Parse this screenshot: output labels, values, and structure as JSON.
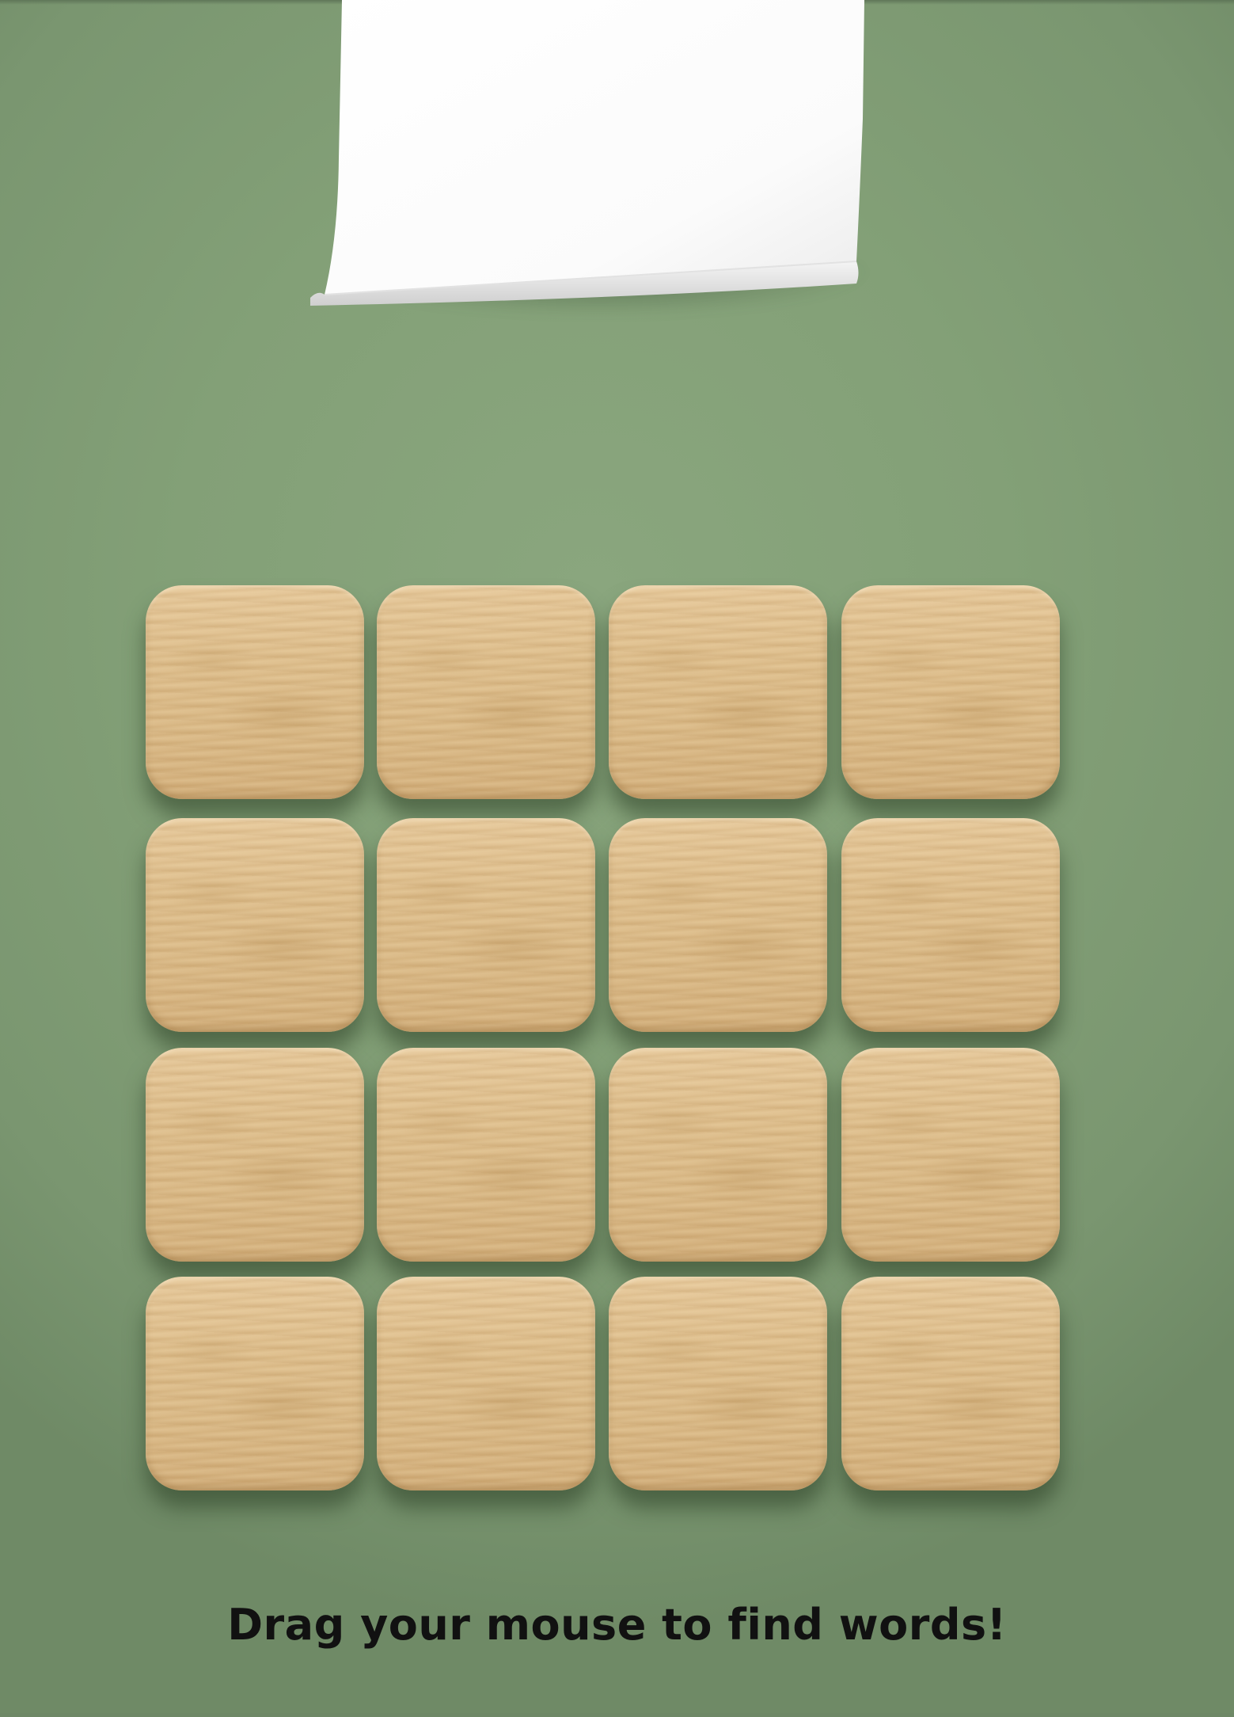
{
  "game": {
    "instruction": "Drag your mouse to find words!",
    "board": {
      "rows": 4,
      "columns": 4,
      "tiles": [
        {
          "letter": ""
        },
        {
          "letter": ""
        },
        {
          "letter": ""
        },
        {
          "letter": ""
        },
        {
          "letter": ""
        },
        {
          "letter": ""
        },
        {
          "letter": ""
        },
        {
          "letter": ""
        },
        {
          "letter": ""
        },
        {
          "letter": ""
        },
        {
          "letter": ""
        },
        {
          "letter": ""
        },
        {
          "letter": ""
        },
        {
          "letter": ""
        },
        {
          "letter": ""
        },
        {
          "letter": ""
        }
      ]
    },
    "word_display": ""
  },
  "colors": {
    "background": "#83a077",
    "tile_wood": "#ddbd8c",
    "paper": "#ffffff",
    "text": "#111111"
  }
}
